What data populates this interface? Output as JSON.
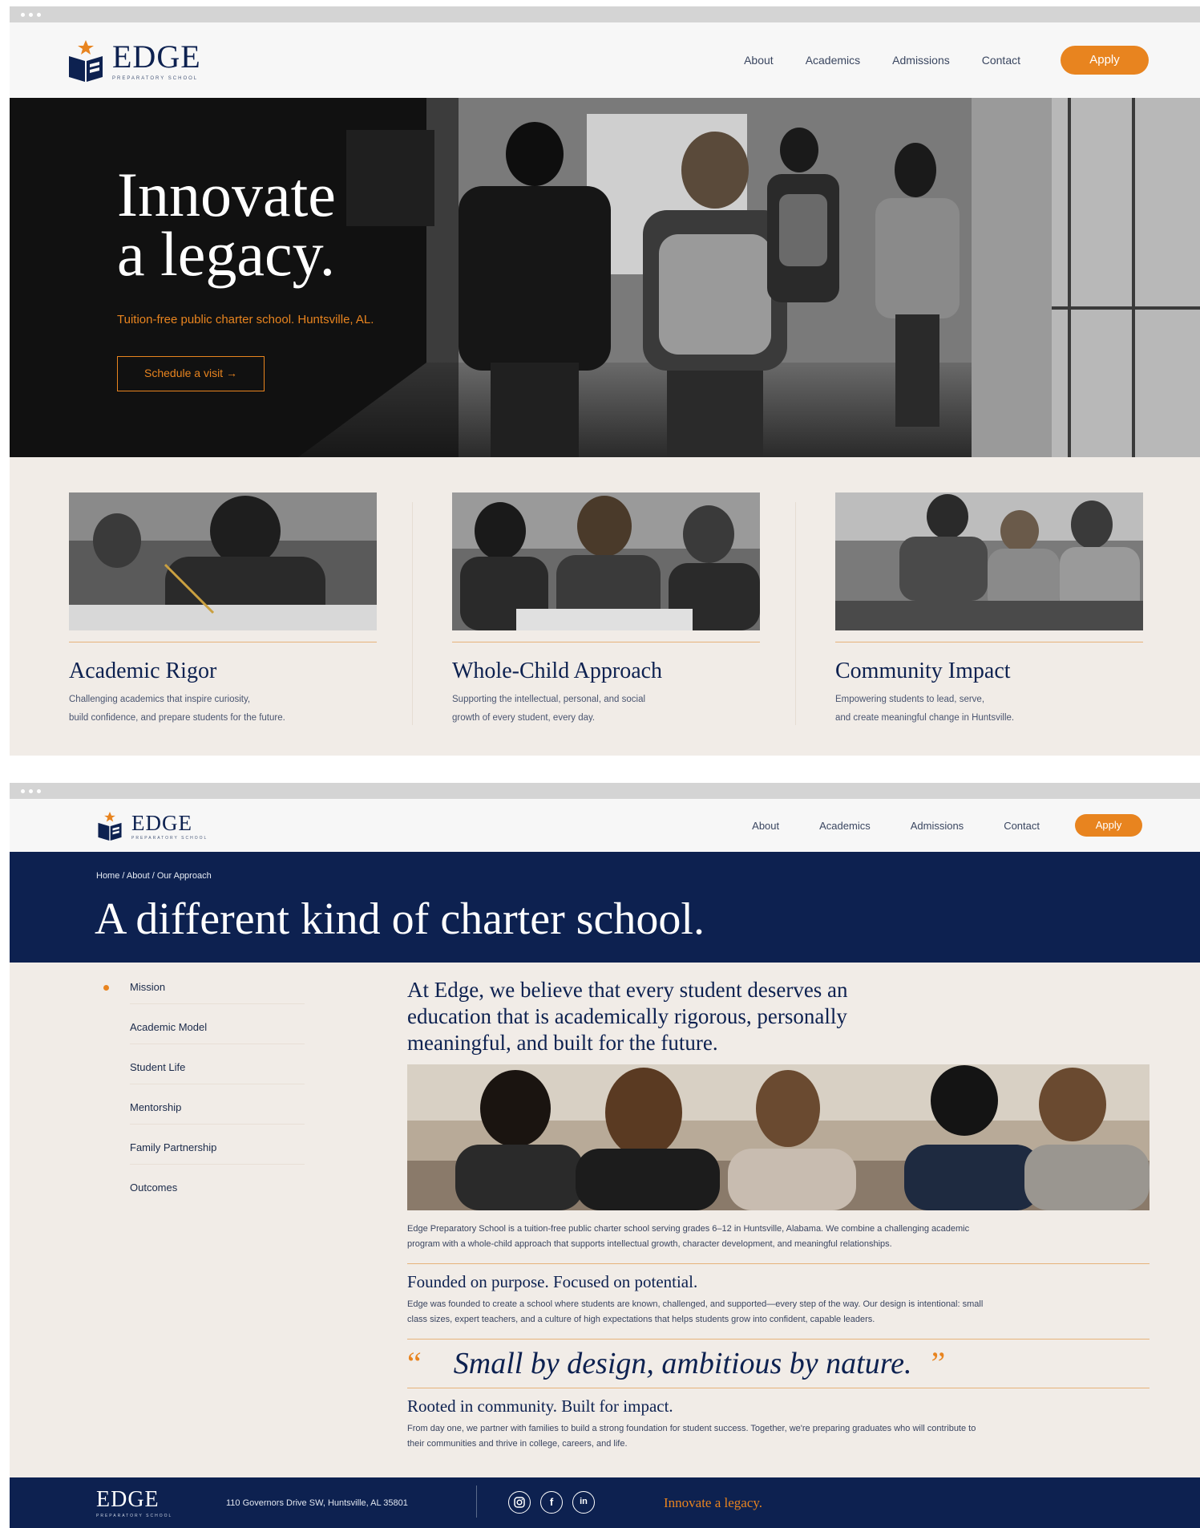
{
  "brand": {
    "name": "EDGE",
    "subtitle": "PREPARATORY SCHOOL",
    "accent": "#e8841f",
    "navy": "#0d2150"
  },
  "nav": {
    "items": [
      "About",
      "Academics",
      "Admissions",
      "Contact"
    ],
    "apply": "Apply"
  },
  "hero": {
    "title": "Innovate\na legacy.",
    "subtitle": "Tuition-free public charter school. Huntsville, AL.",
    "cta": "Schedule a visit →"
  },
  "cards": [
    {
      "title": "Academic Rigor",
      "text": "Challenging academics that inspire curiosity,\nbuild confidence, and prepare students for the future."
    },
    {
      "title": "Whole-Child Approach",
      "text": "Supporting the intellectual, personal, and social\ngrowth of every student, every day."
    },
    {
      "title": "Community Impact",
      "text": "Empowering students to lead, serve,\nand create meaningful change in Huntsville."
    }
  ],
  "about": {
    "breadcrumb": "Home / About / Our Approach",
    "title": "A different kind of charter school.",
    "side_nav": [
      "Mission",
      "Academic Model",
      "Student Life",
      "Mentorship",
      "Family Partnership",
      "Outcomes"
    ],
    "lead": "At Edge, we believe that every student deserves an education that is academically rigorous, personally meaningful, and built for the future.",
    "intro": "Edge Preparatory School is a tuition-free public charter school serving grades 6–12 in Huntsville, Alabama. We combine a challenging academic program with a whole-child approach that supports intellectual growth, character development, and meaningful relationships.",
    "section1_title": "Founded on purpose. Focused on potential.",
    "section1_text": "Edge was founded to create a school where students are known, challenged, and supported—every step of the way. Our design is intentional: small class sizes, expert teachers, and a culture of high expectations that helps students grow into confident, capable leaders.",
    "quote": "Small by design, ambitious by nature.",
    "quote_open": "“",
    "quote_close": "”",
    "section2_title": "Rooted in community. Built for impact.",
    "section2_text": "From day one, we partner with families to build a strong foundation for student success. Together, we're preparing graduates who will contribute to their communities and thrive in college, careers, and life."
  },
  "footer": {
    "address": "110 Governors Drive SW, Huntsville, AL 35801",
    "social": [
      "instagram-icon",
      "facebook-icon",
      "linkedin-icon"
    ],
    "tagline": "Innovate a legacy."
  }
}
